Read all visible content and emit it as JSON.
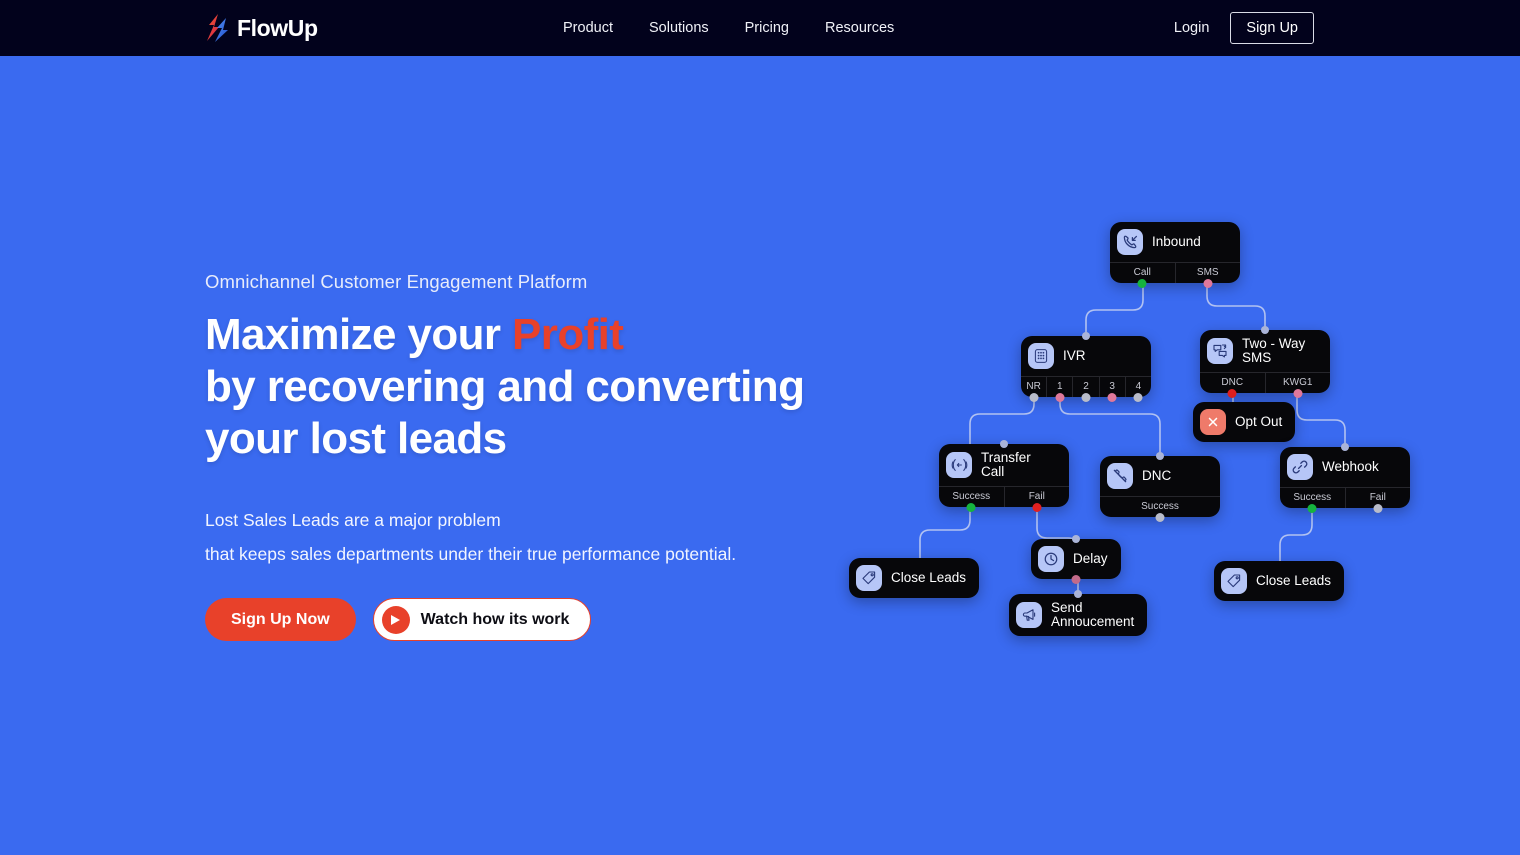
{
  "header": {
    "brand": {
      "name": "FlowUp",
      "logo_icon": "flowup-flame-logo"
    },
    "nav": [
      {
        "label": "Product"
      },
      {
        "label": "Solutions"
      },
      {
        "label": "Pricing"
      },
      {
        "label": "Resources"
      }
    ],
    "login_label": "Login",
    "signup_label": "Sign Up"
  },
  "hero": {
    "eyebrow": "Omnichannel Customer Engagement Platform",
    "headline_line1_a": "Maximize your ",
    "headline_accent": "Profit",
    "headline_line2": "by recovering and converting",
    "headline_line3": "your lost leads",
    "subcopy_line1": "Lost Sales Leads are a major problem",
    "subcopy_line2": "that keeps sales departments under their true performance potential.",
    "cta_primary": "Sign Up Now",
    "cta_secondary": "Watch how its work"
  },
  "colors": {
    "page_background": "#3a6af0",
    "header_background": "#02021c",
    "accent_red": "#e8412a",
    "node_background": "#07070a",
    "node_icon_background": "#b6c6f7",
    "port_success": "#16b33f",
    "port_fail": "#e02020",
    "edge_stroke": "#c8d2f2"
  },
  "flow": {
    "nodes": [
      {
        "id": "inbound",
        "title": "Inbound",
        "icon": "incoming-call-icon",
        "ports": [
          {
            "label": "Call",
            "dot": "green"
          },
          {
            "label": "SMS",
            "dot": "pink"
          }
        ]
      },
      {
        "id": "ivr",
        "title": "IVR",
        "icon": "dialpad-icon",
        "ports": [
          {
            "label": "NR",
            "dot": "grey"
          },
          {
            "label": "1",
            "dot": "pink"
          },
          {
            "label": "2",
            "dot": "grey"
          },
          {
            "label": "3",
            "dot": "pink"
          },
          {
            "label": "4",
            "dot": "grey"
          }
        ]
      },
      {
        "id": "twoway",
        "title": "Two - Way SMS",
        "icon": "two-way-sms-icon",
        "ports": [
          {
            "label": "DNC",
            "dot": "red"
          },
          {
            "label": "KWG1",
            "dot": "pink"
          }
        ]
      },
      {
        "id": "optout",
        "title": "Opt Out",
        "icon": "close-x-icon",
        "ports": []
      },
      {
        "id": "transfer",
        "title": "Transfer Call",
        "icon": "transfer-call-icon",
        "ports": [
          {
            "label": "Success",
            "dot": "green"
          },
          {
            "label": "Fail",
            "dot": "red"
          }
        ]
      },
      {
        "id": "dnc",
        "title": "DNC",
        "icon": "phone-off-icon",
        "ports": [
          {
            "label": "Success",
            "dot": "grey"
          }
        ]
      },
      {
        "id": "webhook",
        "title": "Webhook",
        "icon": "link-chain-icon",
        "ports": [
          {
            "label": "Success",
            "dot": "green"
          },
          {
            "label": "Fail",
            "dot": "grey"
          }
        ]
      },
      {
        "id": "close1",
        "title": "Close Leads",
        "icon": "tag-icon",
        "ports": []
      },
      {
        "id": "delay",
        "title": "Delay",
        "icon": "clock-icon",
        "ports": []
      },
      {
        "id": "close2",
        "title": "Close Leads",
        "icon": "tag-icon",
        "ports": []
      },
      {
        "id": "announce",
        "title": "Send\nAnnoucement",
        "icon": "megaphone-icon",
        "ports": []
      }
    ],
    "edges": [
      {
        "from": "inbound.Call",
        "to": "ivr"
      },
      {
        "from": "inbound.SMS",
        "to": "twoway"
      },
      {
        "from": "ivr.NR",
        "to": "transfer"
      },
      {
        "from": "ivr.1",
        "to": "dnc"
      },
      {
        "from": "twoway.DNC",
        "to": "optout"
      },
      {
        "from": "twoway.KWG1",
        "to": "webhook"
      },
      {
        "from": "transfer.Success",
        "to": "close1"
      },
      {
        "from": "transfer.Fail",
        "to": "delay"
      },
      {
        "from": "delay",
        "to": "announce"
      },
      {
        "from": "webhook.Success",
        "to": "close2"
      }
    ]
  }
}
